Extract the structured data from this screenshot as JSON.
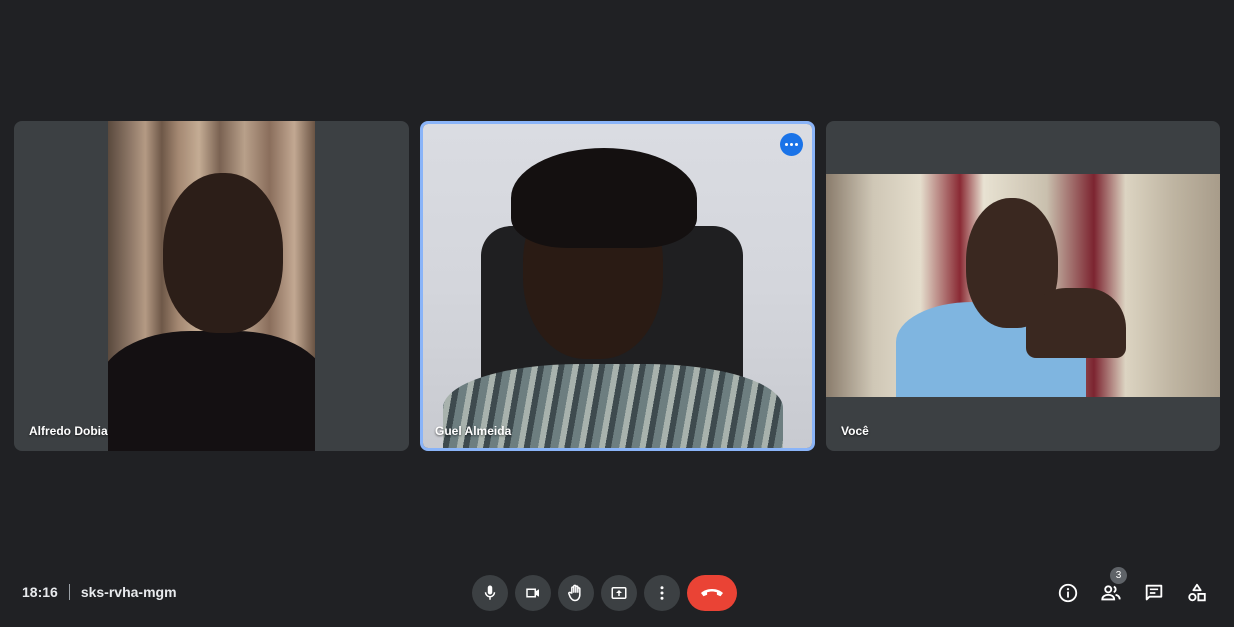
{
  "participants": [
    {
      "name": "Alfredo Dobia"
    },
    {
      "name": "Guel Almeida"
    },
    {
      "name": "Você"
    }
  ],
  "participant_count": "3",
  "meeting": {
    "time": "18:16",
    "code": "sks-rvha-mgm"
  },
  "controls": [
    "microphone",
    "camera",
    "raise-hand",
    "present-screen",
    "more-options",
    "leave-call"
  ],
  "side_controls": [
    "meeting-details",
    "people",
    "chat",
    "activities"
  ],
  "colors": {
    "background": "#202124",
    "tile": "#3c4043",
    "active_speaker_border": "#8ab4f8",
    "leave_button": "#ea4335",
    "badge_blue": "#1a73e8"
  }
}
